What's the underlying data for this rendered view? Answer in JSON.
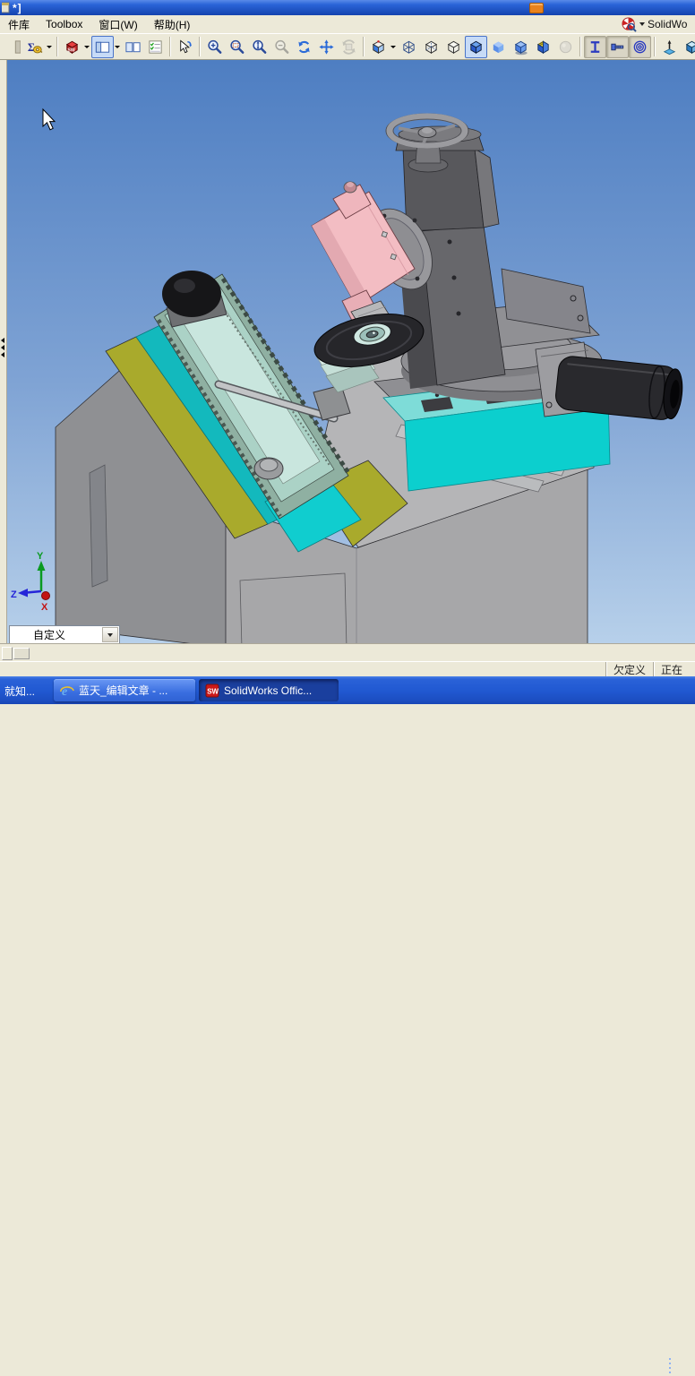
{
  "colors": {
    "sky_top": "#4e7ec2",
    "sky_bottom": "#b7d0ea",
    "yellow": "#a9aa2c",
    "cyan": "#0ccfce",
    "pink": "#f3bdc3",
    "title_blue": "#1e54c8",
    "taskbar_blue": "#2159d2",
    "status_bg": "#ece9d8"
  },
  "title_bar": {
    "title_fragment": "*]",
    "floating_icon": "orange-tag-icon"
  },
  "menu_bar": {
    "items": [
      {
        "label": "件库"
      },
      {
        "label": "Toolbox"
      },
      {
        "label": "窗口(W)"
      },
      {
        "label": "帮助(H)"
      }
    ],
    "search": {
      "icon": "solidworks-search-icon",
      "label": "SolidWo"
    }
  },
  "toolbar": {
    "items": [
      {
        "icon": "partial",
        "name": "clipped-icon"
      },
      {
        "icon": "measure",
        "name": "measure-tool",
        "dropdown": true,
        "sep_after": true
      },
      {
        "icon": "sw-resources",
        "name": "solidworks-resources",
        "dropdown": true
      },
      {
        "icon": "panel-layout",
        "name": "panel-layout",
        "dropdown": true,
        "state": "pressed"
      },
      {
        "icon": "two-pane",
        "name": "two-pane-view"
      },
      {
        "icon": "options-list",
        "name": "options-list",
        "sep_after": true
      },
      {
        "icon": "select",
        "name": "select-tool",
        "sep_after": true
      },
      {
        "icon": "zoom-in",
        "name": "zoom-in"
      },
      {
        "icon": "zoom-area",
        "name": "zoom-area"
      },
      {
        "icon": "zoom-fit",
        "name": "zoom-fit"
      },
      {
        "icon": "zoom-out",
        "name": "zoom-out",
        "state": "disabled"
      },
      {
        "icon": "rotate-view",
        "name": "rotate-view"
      },
      {
        "icon": "pan",
        "name": "pan-view"
      },
      {
        "icon": "rotate-scene",
        "name": "rotate-scene",
        "state": "disabled",
        "sep_after": true
      },
      {
        "icon": "view-orient",
        "name": "view-orientation",
        "dropdown": true
      },
      {
        "icon": "cube-wire",
        "name": "wireframe-mode"
      },
      {
        "icon": "cube-hlv",
        "name": "hidden-lines-visible-mode"
      },
      {
        "icon": "cube-hlr",
        "name": "hidden-lines-removed-mode"
      },
      {
        "icon": "cube-shaded-edges",
        "name": "shaded-with-edges-mode",
        "state": "pressed"
      },
      {
        "icon": "cube-shaded",
        "name": "shaded-mode"
      },
      {
        "icon": "cube-shadow",
        "name": "shadows-mode"
      },
      {
        "icon": "section",
        "name": "section-view"
      },
      {
        "icon": "realview",
        "name": "realview",
        "state": "disabled",
        "sep_after": true
      },
      {
        "icon": "beam",
        "name": "weldment-profile",
        "state": "toggled"
      },
      {
        "icon": "fastener",
        "name": "smart-fastener",
        "state": "toggled"
      },
      {
        "icon": "spring",
        "name": "spring-tool",
        "state": "toggled",
        "sep_after": true
      },
      {
        "icon": "ref-axis",
        "name": "reference-axis"
      },
      {
        "icon": "vcube-shaded",
        "name": "view-cube-shaded"
      },
      {
        "icon": "vcube-wire",
        "name": "view-cube-wireframe"
      }
    ]
  },
  "viewport": {
    "triad": {
      "x": "X",
      "y": "Y",
      "z": "Z"
    },
    "view_selector": {
      "value": "自定义",
      "dropdown_icon": "chevron-down-icon"
    },
    "model_parts": [
      "machine-base",
      "linear-slide-assembly",
      "dome-cover",
      "rotary-table",
      "rotary-base",
      "column",
      "handwheel",
      "wheel-motor",
      "grinding-wheel",
      "tailstock-cylinder"
    ]
  },
  "status_bar": {
    "items": [
      {
        "label": "欠定义"
      },
      {
        "label": "正在"
      }
    ]
  },
  "taskbar": {
    "overflow_label": "就知...",
    "buttons": [
      {
        "icon": "ie-icon",
        "label": "蓝天_编辑文章 - ...",
        "active": false
      },
      {
        "icon": "solidworks-icon",
        "label": "SolidWorks Offic...",
        "active": true
      }
    ]
  }
}
